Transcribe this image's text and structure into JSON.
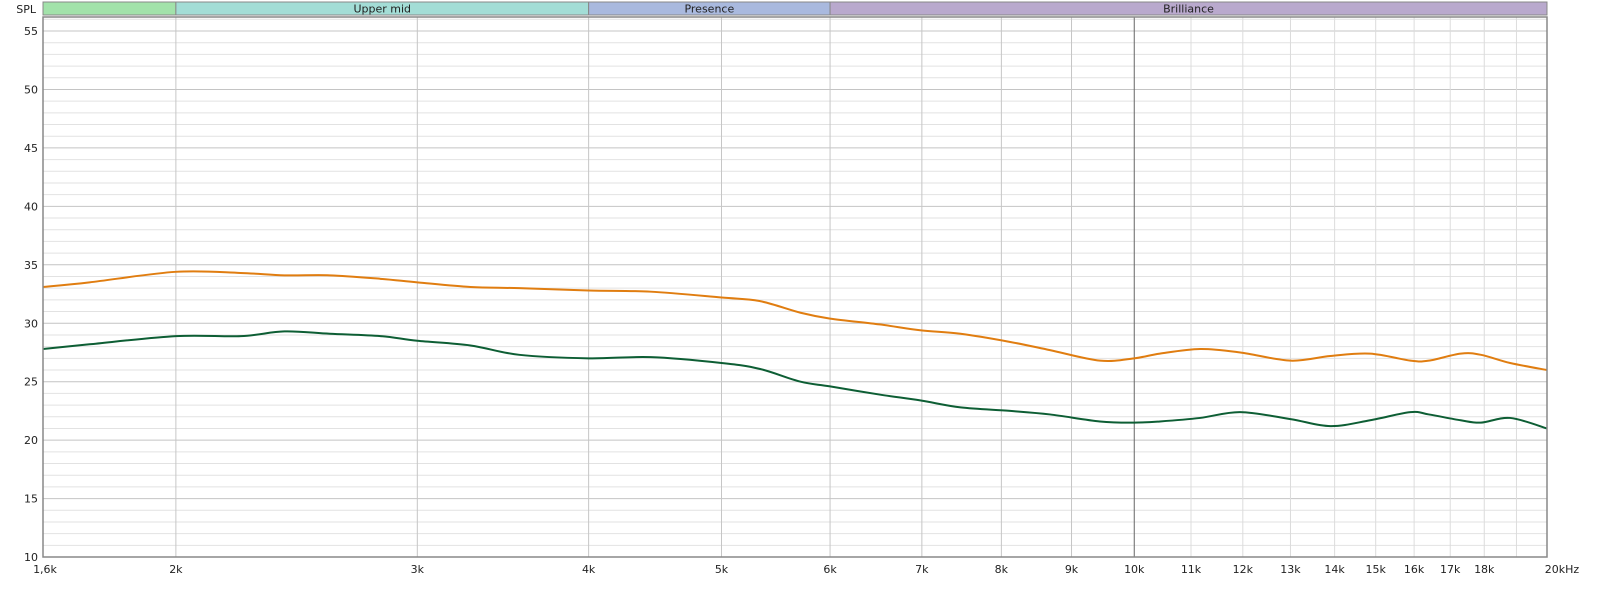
{
  "chart_data": {
    "type": "line",
    "ylabel": "SPL",
    "xunit": "kHz",
    "xscale": "log",
    "xlim": [
      1.6,
      20
    ],
    "ylim": [
      10,
      56
    ],
    "grid": true,
    "yticks": [
      10,
      15,
      20,
      25,
      30,
      35,
      40,
      45,
      50,
      55
    ],
    "xticks": [
      {
        "v": 1.6,
        "label": "1,6k",
        "major": true
      },
      {
        "v": 2,
        "label": "2k",
        "major": true
      },
      {
        "v": 3,
        "label": "3k",
        "major": true
      },
      {
        "v": 4,
        "label": "4k",
        "major": true
      },
      {
        "v": 5,
        "label": "5k",
        "major": true
      },
      {
        "v": 6,
        "label": "6k",
        "major": true
      },
      {
        "v": 7,
        "label": "7k",
        "major": true
      },
      {
        "v": 8,
        "label": "8k",
        "major": true
      },
      {
        "v": 9,
        "label": "9k",
        "major": true
      },
      {
        "v": 10,
        "label": "10k",
        "major": true
      },
      {
        "v": 11,
        "label": "11k",
        "major": false
      },
      {
        "v": 12,
        "label": "12k",
        "major": false
      },
      {
        "v": 13,
        "label": "13k",
        "major": false
      },
      {
        "v": 14,
        "label": "14k",
        "major": false
      },
      {
        "v": 15,
        "label": "15k",
        "major": false
      },
      {
        "v": 16,
        "label": "16k",
        "major": false
      },
      {
        "v": 17,
        "label": "17k",
        "major": false
      },
      {
        "v": 18,
        "label": "18k",
        "major": false
      },
      {
        "v": 20,
        "label": "20kHz",
        "major": true
      }
    ],
    "bands": [
      {
        "label": "",
        "from": 1.6,
        "to": 2,
        "color": "#a2e2aa"
      },
      {
        "label": "Upper mid",
        "from": 2,
        "to": 4,
        "color": "#a3ddd6"
      },
      {
        "label": "Presence",
        "from": 4,
        "to": 6,
        "color": "#a9b9de"
      },
      {
        "label": "Brilliance",
        "from": 6,
        "to": 20,
        "color": "#b9a9cd"
      }
    ],
    "x": [
      1.6,
      1.73,
      2.0,
      2.23,
      2.4,
      2.59,
      2.82,
      3.0,
      3.28,
      3.56,
      4.0,
      4.44,
      5.0,
      5.33,
      5.71,
      6.0,
      6.52,
      6.98,
      7.47,
      8.12,
      8.68,
      9.44,
      10,
      10.44,
      11.17,
      11.95,
      13.0,
      13.9,
      14.86,
      15.9,
      16.4,
      17.3,
      17.9,
      18.8,
      20
    ],
    "series": [
      {
        "name": "orange",
        "color": "#e07d10",
        "values": [
          33.1,
          33.5,
          34.4,
          34.3,
          34.1,
          34.1,
          33.8,
          33.5,
          33.1,
          33.0,
          32.8,
          32.7,
          32.2,
          31.9,
          30.9,
          30.4,
          29.9,
          29.4,
          29.1,
          28.4,
          27.7,
          26.8,
          27.0,
          27.4,
          27.8,
          27.5,
          26.8,
          27.2,
          27.4,
          26.8,
          26.8,
          27.4,
          27.3,
          26.6,
          26.0
        ]
      },
      {
        "name": "green",
        "color": "#0d5e34",
        "values": [
          27.8,
          28.2,
          28.9,
          28.9,
          29.3,
          29.1,
          28.9,
          28.5,
          28.1,
          27.3,
          27.0,
          27.1,
          26.6,
          26.1,
          25.0,
          24.6,
          23.9,
          23.4,
          22.8,
          22.5,
          22.2,
          21.6,
          21.5,
          21.6,
          21.9,
          22.4,
          21.8,
          21.2,
          21.7,
          22.4,
          22.2,
          21.7,
          21.5,
          21.9,
          21.0
        ]
      }
    ]
  }
}
